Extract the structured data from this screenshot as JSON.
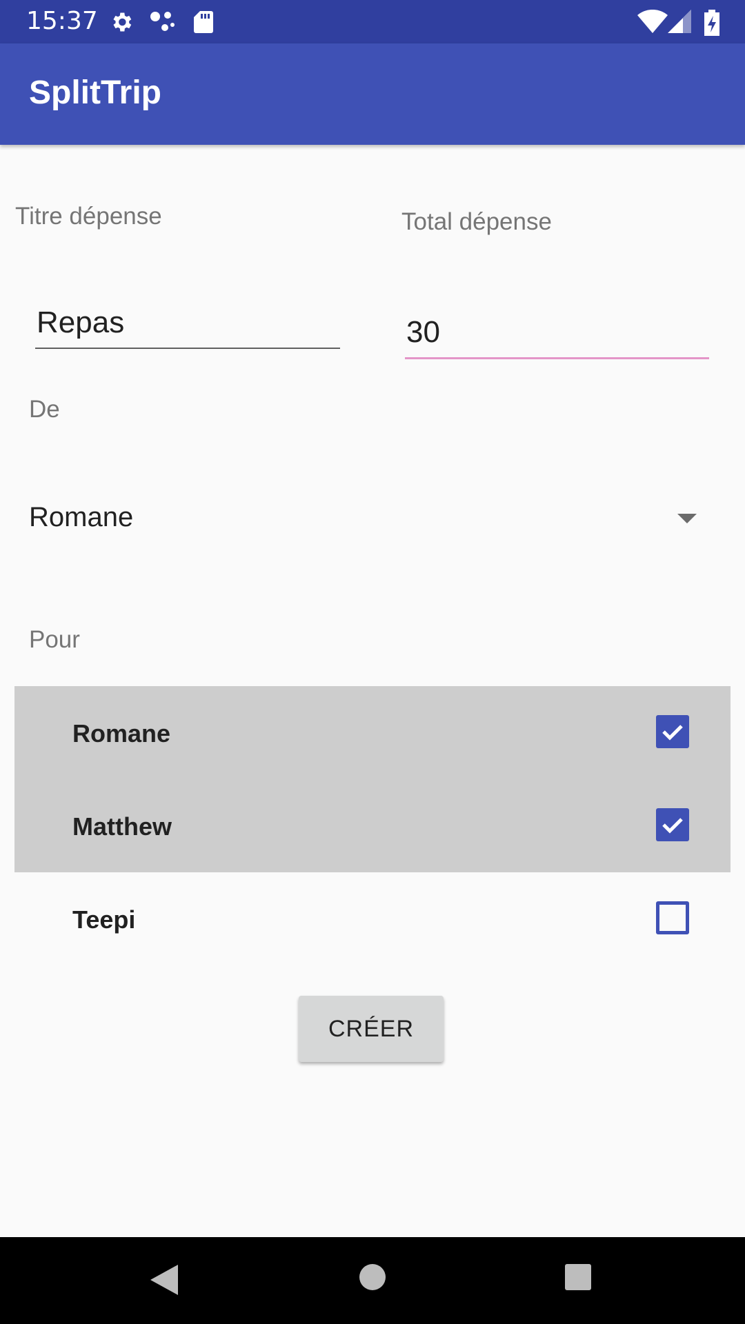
{
  "status_bar": {
    "time": "15:37",
    "icons_left": [
      "gear-icon",
      "dots-icon",
      "sd-card-icon"
    ],
    "icons_right": [
      "wifi-icon",
      "cell-signal-icon",
      "battery-charging-icon"
    ]
  },
  "app_bar": {
    "title": "SplitTrip"
  },
  "form": {
    "title_label": "Titre dépense",
    "title_value": "Repas",
    "total_label": "Total dépense",
    "total_value": "30",
    "from_label": "De",
    "from_selected": "Romane",
    "for_label": "Pour",
    "participants": [
      {
        "name": "Romane",
        "checked": true
      },
      {
        "name": "Matthew",
        "checked": true
      },
      {
        "name": "Teepi",
        "checked": false
      }
    ],
    "create_label": "CRÉER"
  },
  "colors": {
    "primary": "#3f51b5",
    "primary_dark": "#303f9f",
    "accent_underline": "#e495c8",
    "selected_row": "#cdcdcd"
  },
  "nav_bar": {
    "icons": [
      "back-icon",
      "home-icon",
      "recents-icon"
    ]
  }
}
